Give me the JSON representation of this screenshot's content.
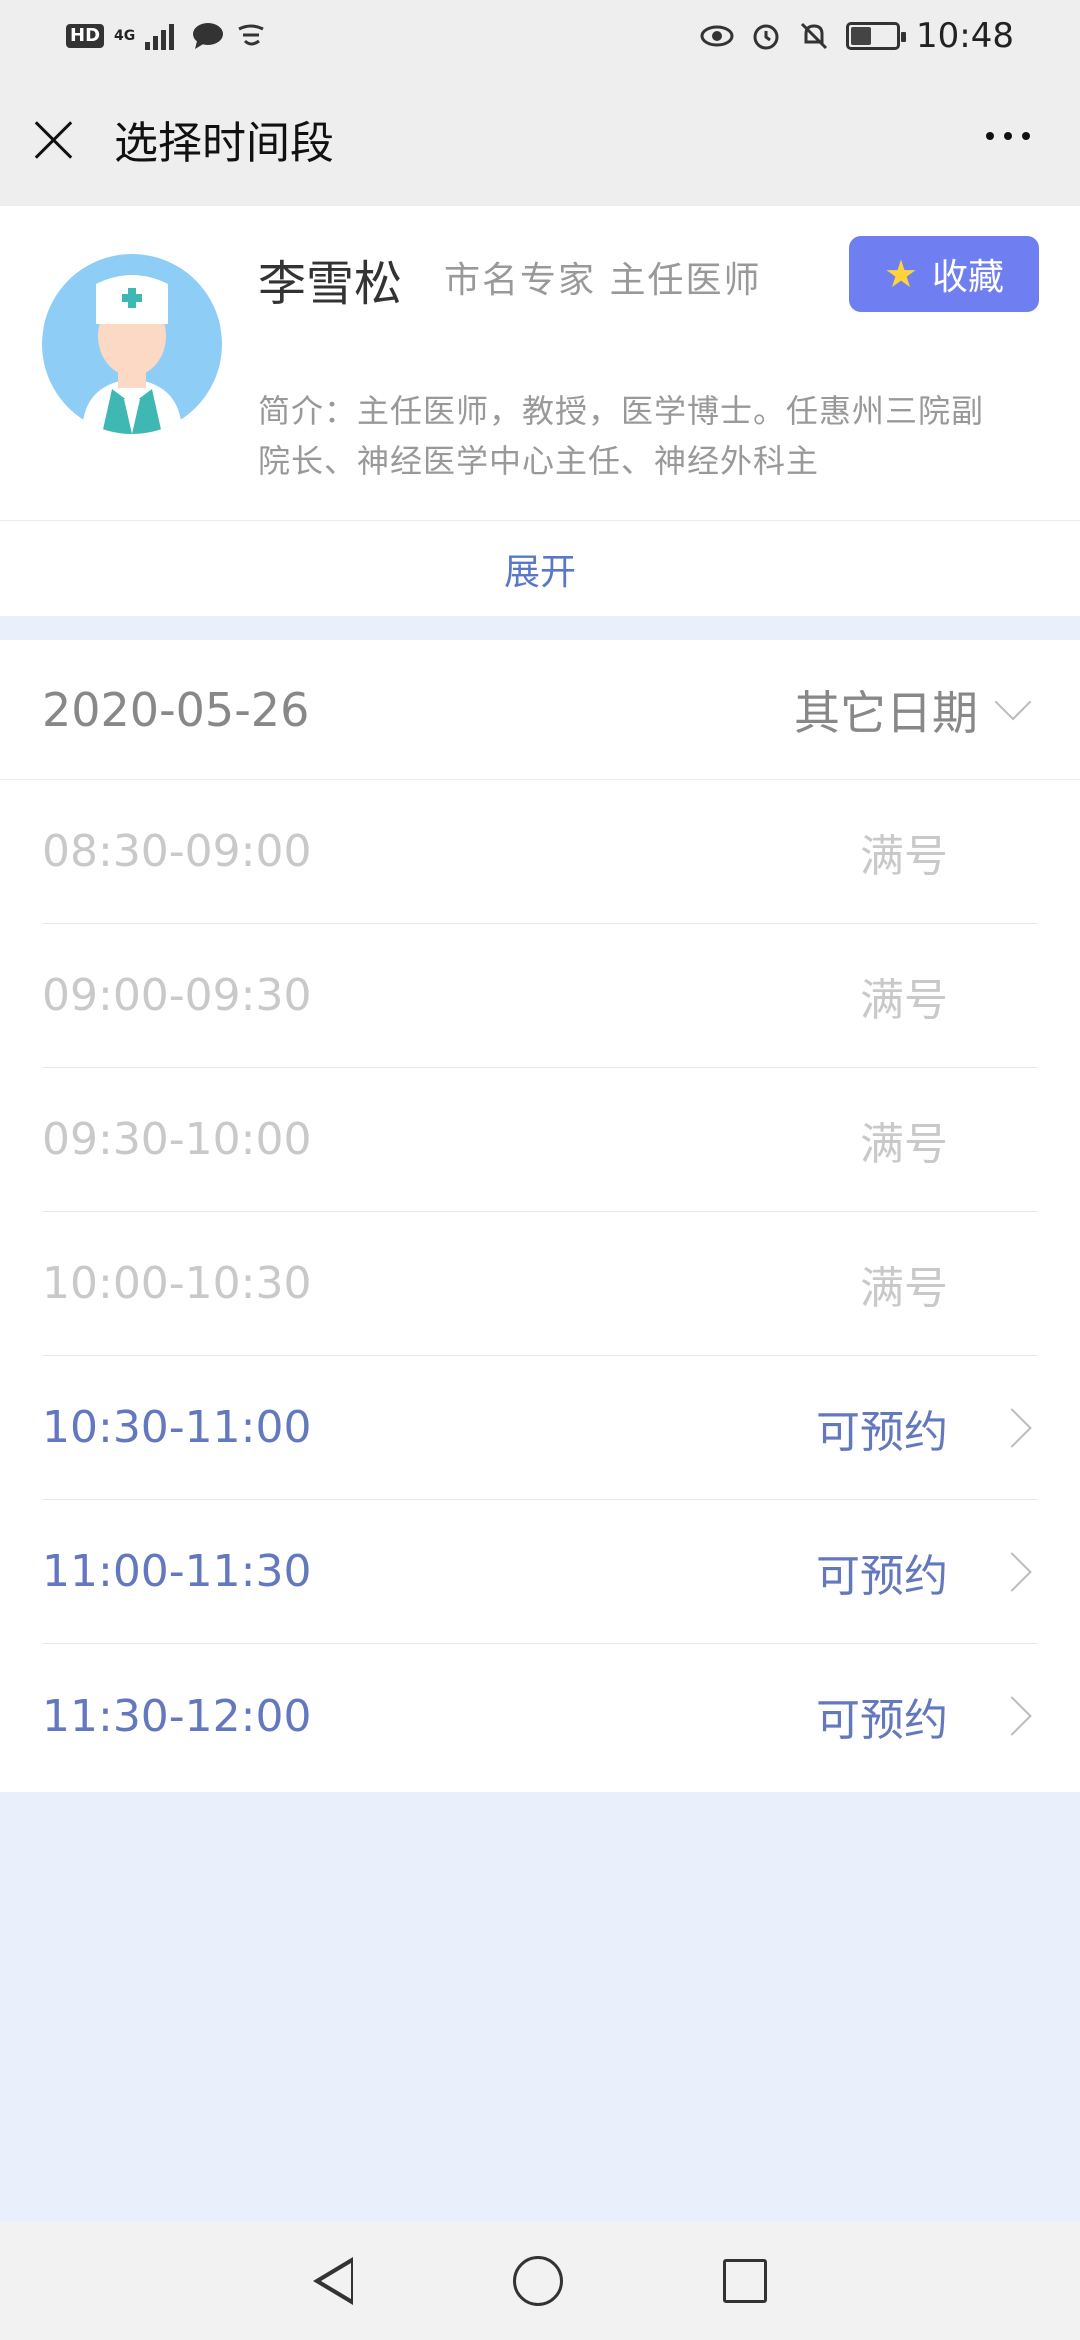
{
  "status_bar": {
    "hd_label": "HD",
    "network_label": "4G",
    "time": "10:48",
    "icons": [
      "signal-icon",
      "chat-icon",
      "app-icon",
      "eye-icon",
      "alarm-icon",
      "mute-icon",
      "battery-icon"
    ],
    "battery_level": 0.45
  },
  "nav": {
    "title": "选择时间段",
    "close_icon": "close-icon",
    "more_icon": "more-icon"
  },
  "doctor": {
    "name": "李雪松",
    "title": "市名专家 主任医师",
    "intro": "简介：主任医师，教授，医学博士。任惠州三院副院长、神经医学中心主任、神经外科主",
    "favorite_label": "收藏",
    "expand_label": "展开"
  },
  "schedule": {
    "date": "2020-05-26",
    "other_date_label": "其它日期",
    "slots": [
      {
        "time": "08:30-09:00",
        "status": "满号"
      },
      {
        "time": "09:00-09:30",
        "status": "满号"
      },
      {
        "time": "09:30-10:00",
        "status": "满号"
      },
      {
        "time": "10:00-10:30",
        "status": "满号"
      },
      {
        "time": "10:30-11:00",
        "status": "可预约"
      },
      {
        "time": "11:00-11:30",
        "status": "可预约"
      },
      {
        "time": "11:30-12:00",
        "status": "可预约"
      }
    ]
  },
  "colors": {
    "accent": "#6f7ef0",
    "available_text": "#6478c0",
    "full_text": "#c9c9c9",
    "page_bg": "#eaf0fb"
  }
}
